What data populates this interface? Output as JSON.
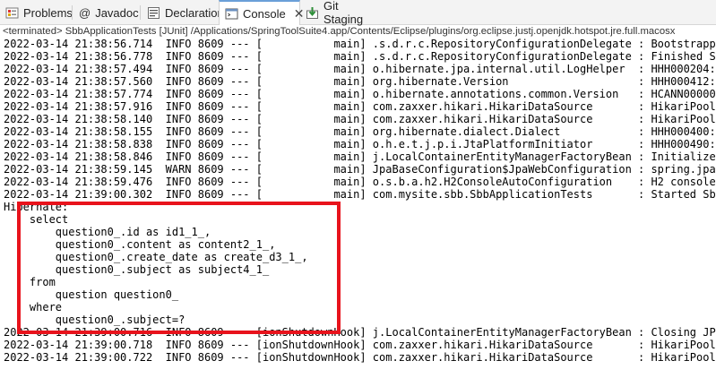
{
  "tabs": [
    {
      "label": "Problems",
      "icon": "problems-icon"
    },
    {
      "label": "Javadoc",
      "icon": "at-icon"
    },
    {
      "label": "Declaration",
      "icon": "declaration-icon"
    },
    {
      "label": "Console",
      "icon": "console-icon",
      "close": "✕"
    },
    {
      "label": "Git Staging",
      "icon": "git-staging-icon"
    }
  ],
  "status": "<terminated> SbbApplicationTests [JUnit] /Applications/SpringToolSuite4.app/Contents/Eclipse/plugins/org.eclipse.justj.openjdk.hotspot.jre.full.macosx",
  "console": {
    "lines": [
      "2022-03-14 21:38:56.714  INFO 8609 --- [           main] .s.d.r.c.RepositoryConfigurationDelegate : Bootstrapp",
      "2022-03-14 21:38:56.778  INFO 8609 --- [           main] .s.d.r.c.RepositoryConfigurationDelegate : Finished S",
      "2022-03-14 21:38:57.494  INFO 8609 --- [           main] o.hibernate.jpa.internal.util.LogHelper  : HHH000204:",
      "2022-03-14 21:38:57.560  INFO 8609 --- [           main] org.hibernate.Version                    : HHH000412:",
      "2022-03-14 21:38:57.774  INFO 8609 --- [           main] o.hibernate.annotations.common.Version   : HCANN00000",
      "2022-03-14 21:38:57.916  INFO 8609 --- [           main] com.zaxxer.hikari.HikariDataSource       : HikariPool",
      "2022-03-14 21:38:58.140  INFO 8609 --- [           main] com.zaxxer.hikari.HikariDataSource       : HikariPool",
      "2022-03-14 21:38:58.155  INFO 8609 --- [           main] org.hibernate.dialect.Dialect            : HHH000400:",
      "2022-03-14 21:38:58.838  INFO 8609 --- [           main] o.h.e.t.j.p.i.JtaPlatformInitiator       : HHH000490:",
      "2022-03-14 21:38:58.846  INFO 8609 --- [           main] j.LocalContainerEntityManagerFactoryBean : Initialize",
      "2022-03-14 21:38:59.145  WARN 8609 --- [           main] JpaBaseConfiguration$JpaWebConfiguration : spring.jpa",
      "2022-03-14 21:38:59.476  INFO 8609 --- [           main] o.s.b.a.h2.H2ConsoleAutoConfiguration    : H2 console",
      "2022-03-14 21:39:00.302  INFO 8609 --- [           main] com.mysite.sbb.SbbApplicationTests       : Started Sb",
      "Hibernate: ",
      "    select",
      "        question0_.id as id1_1_,",
      "        question0_.content as content2_1_,",
      "        question0_.create_date as create_d3_1_,",
      "        question0_.subject as subject4_1_ ",
      "    from",
      "        question question0_ ",
      "    where",
      "        question0_.subject=?",
      "2022-03-14 21:39:00.716  INFO 8609 --- [ionShutdownHook] j.LocalContainerEntityManagerFactoryBean : Closing JP",
      "2022-03-14 21:39:00.718  INFO 8609 --- [ionShutdownHook] com.zaxxer.hikari.HikariDataSource       : HikariPool",
      "2022-03-14 21:39:00.722  INFO 8609 --- [ionShutdownHook] com.zaxxer.hikari.HikariDataSource       : HikariPool"
    ]
  },
  "colors": {
    "highlight": "#e8131c",
    "active_tab_accent": "#6a9fd8"
  }
}
